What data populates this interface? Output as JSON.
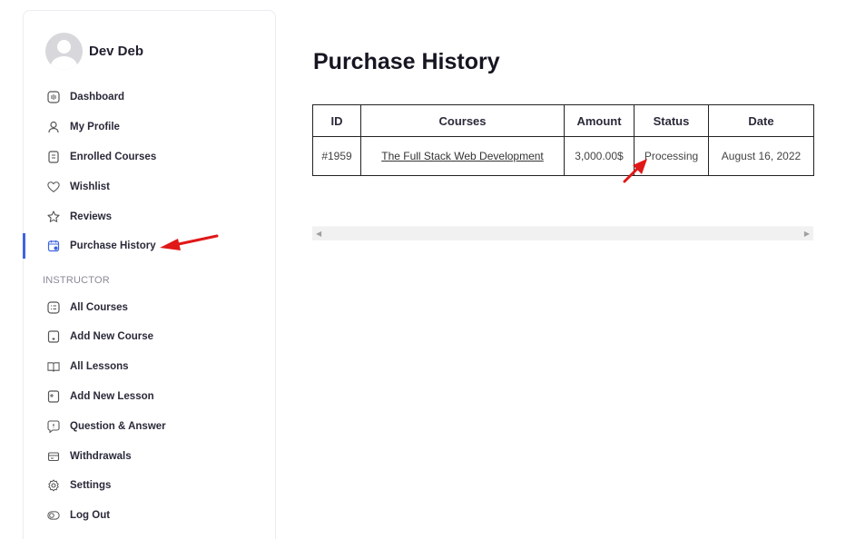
{
  "profile": {
    "name": "Dev Deb"
  },
  "menu": {
    "student_items": [
      {
        "label": "Dashboard",
        "icon": "dashboard-icon"
      },
      {
        "label": "My Profile",
        "icon": "user-icon"
      },
      {
        "label": "Enrolled Courses",
        "icon": "book-icon"
      },
      {
        "label": "Wishlist",
        "icon": "heart-icon"
      },
      {
        "label": "Reviews",
        "icon": "star-icon"
      },
      {
        "label": "Purchase History",
        "icon": "calendar-cart-icon",
        "active": true
      }
    ],
    "section_title": "INSTRUCTOR",
    "instructor_items": [
      {
        "label": "All Courses",
        "icon": "courses-icon"
      },
      {
        "label": "Add New Course",
        "icon": "add-course-icon"
      },
      {
        "label": "All Lessons",
        "icon": "lessons-icon"
      },
      {
        "label": "Add New Lesson",
        "icon": "add-lesson-icon"
      },
      {
        "label": "Question & Answer",
        "icon": "question-icon"
      },
      {
        "label": "Withdrawals",
        "icon": "wallet-icon"
      },
      {
        "label": "Settings",
        "icon": "gear-icon"
      },
      {
        "label": "Log Out",
        "icon": "logout-toggle-icon"
      }
    ]
  },
  "main": {
    "title": "Purchase History",
    "table": {
      "headers": [
        "ID",
        "Courses",
        "Amount",
        "Status",
        "Date"
      ],
      "rows": [
        {
          "id": "#1959",
          "course": "The Full Stack Web Development",
          "amount": "3,000.00$",
          "status": "Processing",
          "date": "August 16, 2022"
        }
      ]
    }
  },
  "colors": {
    "accent": "#3e64de",
    "annotation_arrow": "#e01818"
  }
}
